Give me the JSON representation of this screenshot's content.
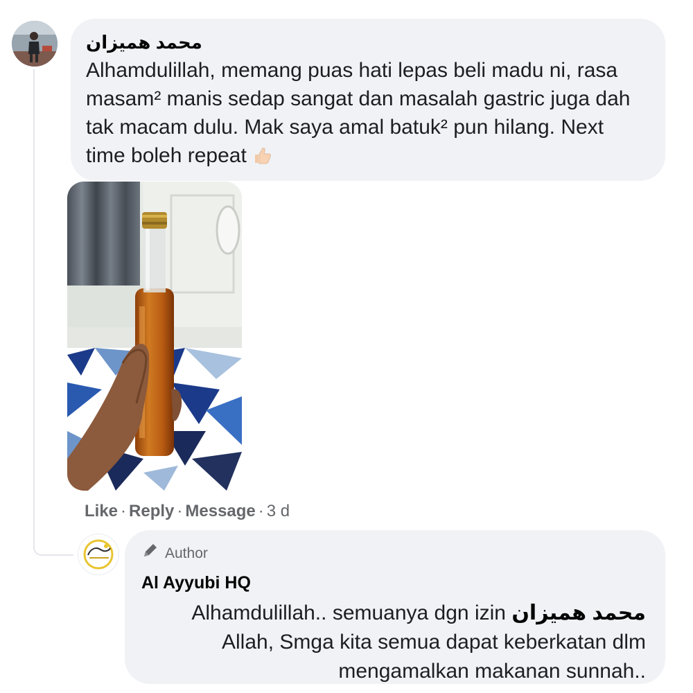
{
  "comment": {
    "author": "محمد هميزان",
    "text": "Alhamdulillah, memang puas hati lepas beli madu ni, rasa masam² manis sedap sangat dan masalah gastric juga dah tak macam dulu. Mak saya amal batuk² pun hilang. Next time boleh repeat",
    "emoji": "thumbs-up-icon",
    "actions": {
      "like": "Like",
      "reply": "Reply",
      "message": "Message",
      "separator": "·",
      "time": "3 d"
    }
  },
  "reply": {
    "badge": "Author",
    "author": "Al Ayyubi HQ",
    "text_before": "Alhamdulillah.. semuanya dgn izin ",
    "mention": "محمد هميزان",
    "text_after": "Allah, Smga kita semua dapat keberkatan dlm mengamalkan makanan sunnah.."
  },
  "colors": {
    "bubble": "#f0f2f5",
    "meta": "#65676b",
    "honey": "#c8731a"
  }
}
